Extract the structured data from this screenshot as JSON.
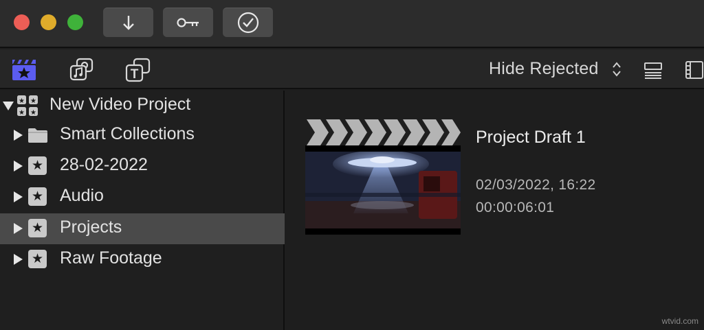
{
  "window": {
    "controls": [
      "close",
      "minimize",
      "zoom"
    ]
  },
  "titlebar": {
    "buttons": [
      {
        "icon": "import-arrow-icon"
      },
      {
        "icon": "keyword-key-icon"
      },
      {
        "icon": "analyze-check-icon"
      }
    ]
  },
  "toolbar": {
    "filter_label": "Hide Rejected",
    "tools": [
      "libraries-icon",
      "photos-audio-icon",
      "titles-generators-icon"
    ]
  },
  "sidebar": {
    "library": {
      "label": "New Video Project",
      "expanded": true
    },
    "items": [
      {
        "label": "Smart Collections",
        "icon": "folder-icon",
        "selected": false
      },
      {
        "label": "28-02-2022",
        "icon": "event-star-icon",
        "selected": false
      },
      {
        "label": "Audio",
        "icon": "event-star-icon",
        "selected": false
      },
      {
        "label": "Projects",
        "icon": "event-star-icon",
        "selected": true
      },
      {
        "label": "Raw Footage",
        "icon": "event-star-icon",
        "selected": false
      }
    ]
  },
  "browser": {
    "project": {
      "title": "Project Draft 1",
      "date": "02/03/2022, 16:22",
      "duration": "00:00:06:01"
    }
  },
  "watermark": "wtvid.com",
  "colors": {
    "accent": "#5b5cf0",
    "selection": "#4a4a4a",
    "background": "#1e1e1e"
  }
}
